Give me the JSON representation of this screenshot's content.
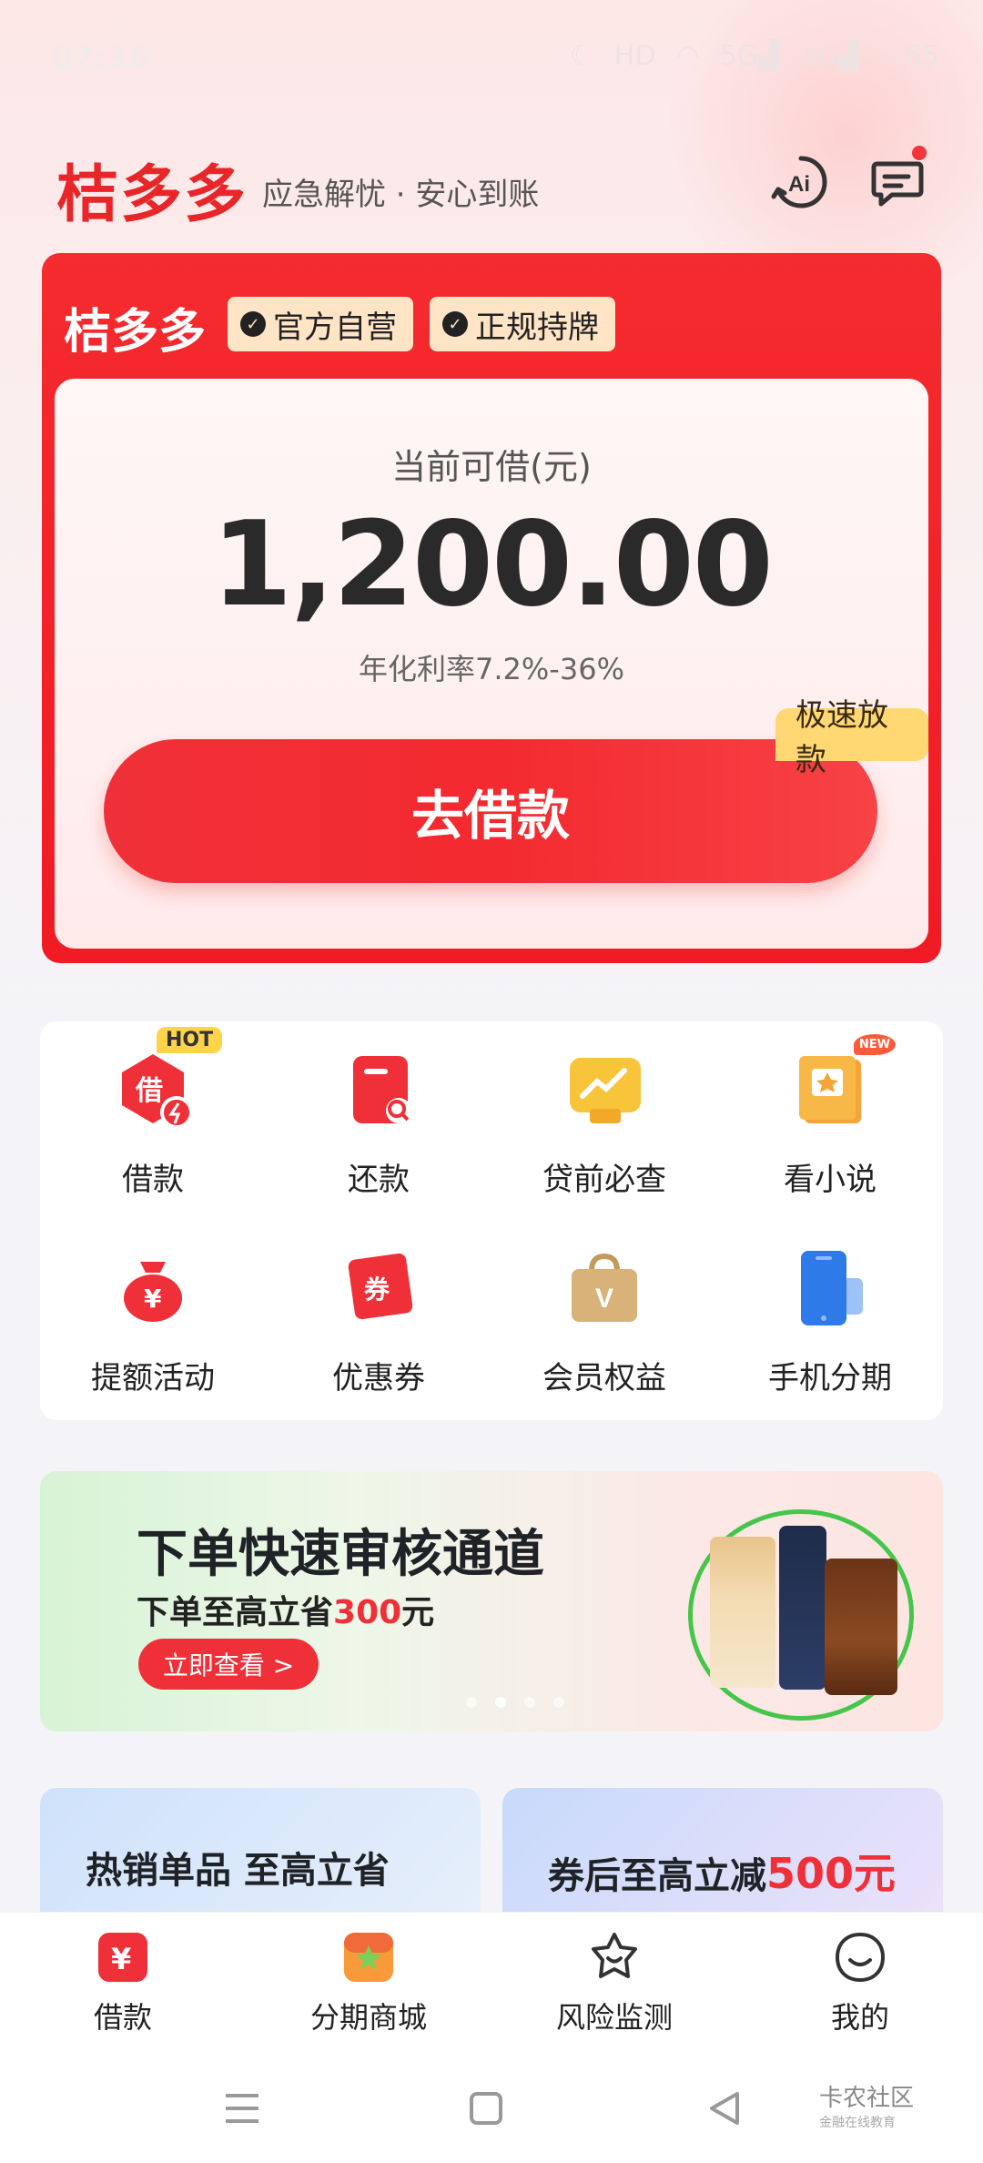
{
  "status_bar": {
    "time": "07:36",
    "icons": [
      "moon-icon",
      "hd-icon",
      "wifi-icon",
      "5g-signal-icon",
      "4g-signal-icon",
      "battery-icon"
    ],
    "battery": "65"
  },
  "header": {
    "brand": "桔多多",
    "slogan": "应急解忧 · 安心到账"
  },
  "loan_card": {
    "brand": "桔多多",
    "badges": [
      "官方自营",
      "正规持牌"
    ],
    "available_label": "当前可借(元)",
    "amount": "1,200.00",
    "rate_text": "年化利率7.2%-36%",
    "fast_tag": "极速放款",
    "borrow_button": "去借款"
  },
  "grid": {
    "items": [
      {
        "label": "借款",
        "tag": "HOT",
        "icon": "borrow-icon"
      },
      {
        "label": "还款",
        "icon": "repay-icon"
      },
      {
        "label": "贷前必查",
        "icon": "chart-check-icon"
      },
      {
        "label": "看小说",
        "tag": "NEW",
        "icon": "book-icon"
      },
      {
        "label": "提额活动",
        "icon": "money-bag-icon"
      },
      {
        "label": "优惠券",
        "icon": "coupon-icon"
      },
      {
        "label": "会员权益",
        "icon": "vip-bag-icon"
      },
      {
        "label": "手机分期",
        "icon": "phone-icon"
      }
    ]
  },
  "banner": {
    "title": "下单快速审核通道",
    "sub_prefix": "下单至高立省",
    "sub_highlight": "300",
    "sub_suffix": "元",
    "button": "立即查看 >",
    "active_page": 2,
    "page_count": 4
  },
  "promos": [
    {
      "text": "热销单品 至高立省"
    },
    {
      "prefix": "券后至高立减",
      "highlight": "500元"
    }
  ],
  "tabbar": {
    "tabs": [
      {
        "label": "借款",
        "icon": "yuan-icon"
      },
      {
        "label": "分期商城",
        "icon": "mall-icon"
      },
      {
        "label": "风险监测",
        "icon": "shield-star-icon"
      },
      {
        "label": "我的",
        "icon": "profile-smile-icon"
      }
    ]
  },
  "watermark": {
    "main": "卡农社区",
    "sub": "金融在线教育"
  },
  "colors": {
    "brand_red": "#f03038",
    "badge_bg": "#ffe4c6",
    "fast_tag_bg": "#ffd873"
  }
}
